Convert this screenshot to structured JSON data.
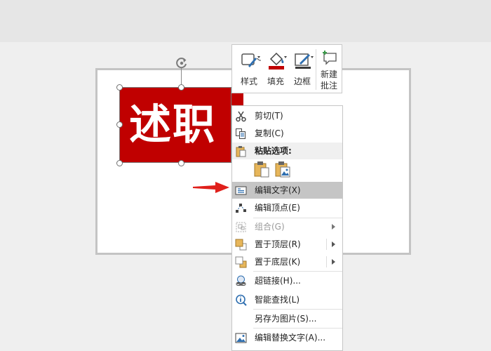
{
  "shape": {
    "text": "述职",
    "fill_color": "#c00000"
  },
  "mini_toolbar": {
    "style_label": "样式",
    "fill_label": "填充",
    "border_label": "边框",
    "new_comment_line1": "新建",
    "new_comment_line2": "批注",
    "fill_accent": "#c00000",
    "icon_accent": "#2f6fb0"
  },
  "context_menu": {
    "cut": "剪切(T)",
    "copy": "复制(C)",
    "paste_options": "粘贴选项:",
    "edit_text": "编辑文字(X)",
    "edit_points": "编辑顶点(E)",
    "group": "组合(G)",
    "bring_to_front": "置于顶层(R)",
    "send_to_back": "置于底层(K)",
    "hyperlink": "超链接(H)...",
    "smart_lookup": "智能查找(L)",
    "save_as_picture": "另存为图片(S)...",
    "edit_alt_text": "编辑替换文字(A)...",
    "highlight_color": "#c5c5c5"
  },
  "annotation": {
    "arrow_color": "#e0201b"
  }
}
